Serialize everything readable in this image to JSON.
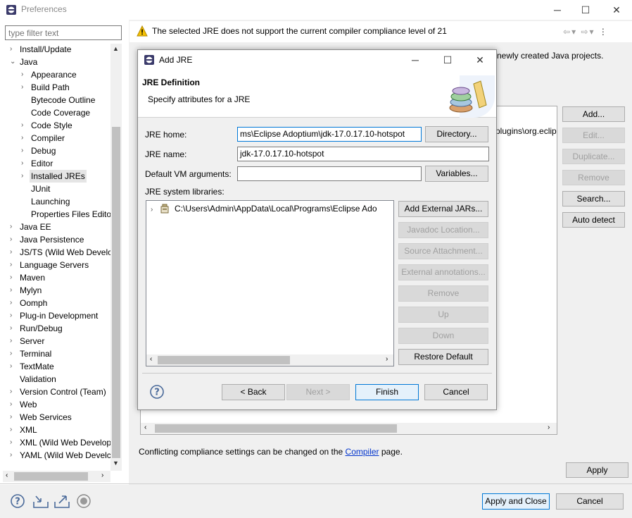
{
  "window": {
    "title": "Preferences"
  },
  "filter": {
    "placeholder": "type filter text"
  },
  "tree": [
    {
      "label": "Install/Update",
      "level": 0,
      "arrow": "›"
    },
    {
      "label": "Java",
      "level": 0,
      "arrow": "⌄"
    },
    {
      "label": "Appearance",
      "level": 1,
      "arrow": "›"
    },
    {
      "label": "Build Path",
      "level": 1,
      "arrow": "›"
    },
    {
      "label": "Bytecode Outline",
      "level": 1,
      "arrow": ""
    },
    {
      "label": "Code Coverage",
      "level": 1,
      "arrow": ""
    },
    {
      "label": "Code Style",
      "level": 1,
      "arrow": "›"
    },
    {
      "label": "Compiler",
      "level": 1,
      "arrow": "›"
    },
    {
      "label": "Debug",
      "level": 1,
      "arrow": "›"
    },
    {
      "label": "Editor",
      "level": 1,
      "arrow": "›"
    },
    {
      "label": "Installed JREs",
      "level": 1,
      "arrow": "›",
      "selected": true
    },
    {
      "label": "JUnit",
      "level": 1,
      "arrow": ""
    },
    {
      "label": "Launching",
      "level": 1,
      "arrow": ""
    },
    {
      "label": "Properties Files Edito",
      "level": 1,
      "arrow": ""
    },
    {
      "label": "Java EE",
      "level": 0,
      "arrow": "›"
    },
    {
      "label": "Java Persistence",
      "level": 0,
      "arrow": "›"
    },
    {
      "label": "JS/TS (Wild Web Develc",
      "level": 0,
      "arrow": "›"
    },
    {
      "label": "Language Servers",
      "level": 0,
      "arrow": "›"
    },
    {
      "label": "Maven",
      "level": 0,
      "arrow": "›"
    },
    {
      "label": "Mylyn",
      "level": 0,
      "arrow": "›"
    },
    {
      "label": "Oomph",
      "level": 0,
      "arrow": "›"
    },
    {
      "label": "Plug-in Development",
      "level": 0,
      "arrow": "›"
    },
    {
      "label": "Run/Debug",
      "level": 0,
      "arrow": "›"
    },
    {
      "label": "Server",
      "level": 0,
      "arrow": "›"
    },
    {
      "label": "Terminal",
      "level": 0,
      "arrow": "›"
    },
    {
      "label": "TextMate",
      "level": 0,
      "arrow": "›"
    },
    {
      "label": "Validation",
      "level": 0,
      "arrow": ""
    },
    {
      "label": "Version Control (Team)",
      "level": 0,
      "arrow": "›"
    },
    {
      "label": "Web",
      "level": 0,
      "arrow": "›"
    },
    {
      "label": "Web Services",
      "level": 0,
      "arrow": "›"
    },
    {
      "label": "XML",
      "level": 0,
      "arrow": "›"
    },
    {
      "label": "XML (Wild Web Develop",
      "level": 0,
      "arrow": "›"
    },
    {
      "label": "YAML (Wild Web Develc",
      "level": 0,
      "arrow": "›"
    }
  ],
  "page": {
    "warning": "The selected JRE does not support the current compiler compliance level of 21",
    "bg_text": "newly created Java projects.",
    "table_text": "plugins\\org.eclip",
    "compliance_prefix": "Conflicting compliance settings can be changed on the ",
    "compliance_link": "Compiler",
    "compliance_suffix": " page.",
    "buttons": {
      "add": "Add...",
      "edit": "Edit...",
      "duplicate": "Duplicate...",
      "remove": "Remove",
      "search": "Search...",
      "auto_detect": "Auto detect",
      "apply": "Apply",
      "apply_close": "Apply and Close",
      "cancel": "Cancel"
    }
  },
  "dialog": {
    "title": "Add JRE",
    "header_title": "JRE Definition",
    "header_subtitle": "Specify attributes for a JRE",
    "jre_home_label": "JRE home:",
    "jre_home_value": "ms\\Eclipse Adoptium\\jdk-17.0.17.10-hotspot",
    "jre_name_label": "JRE name:",
    "jre_name_value": "jdk-17.0.17.10-hotspot",
    "vm_args_label": "Default VM arguments:",
    "vm_args_value": "",
    "libs_label": "JRE system libraries:",
    "lib_entry": "C:\\Users\\Admin\\AppData\\Local\\Programs\\Eclipse Ado",
    "buttons": {
      "directory": "Directory...",
      "variables": "Variables...",
      "add_external_jars": "Add External JARs...",
      "javadoc_location": "Javadoc Location...",
      "source_attachment": "Source Attachment...",
      "external_annotations": "External annotations...",
      "remove": "Remove",
      "up": "Up",
      "down": "Down",
      "restore_default": "Restore Default",
      "back": "< Back",
      "next": "Next >",
      "finish": "Finish",
      "cancel": "Cancel"
    }
  }
}
